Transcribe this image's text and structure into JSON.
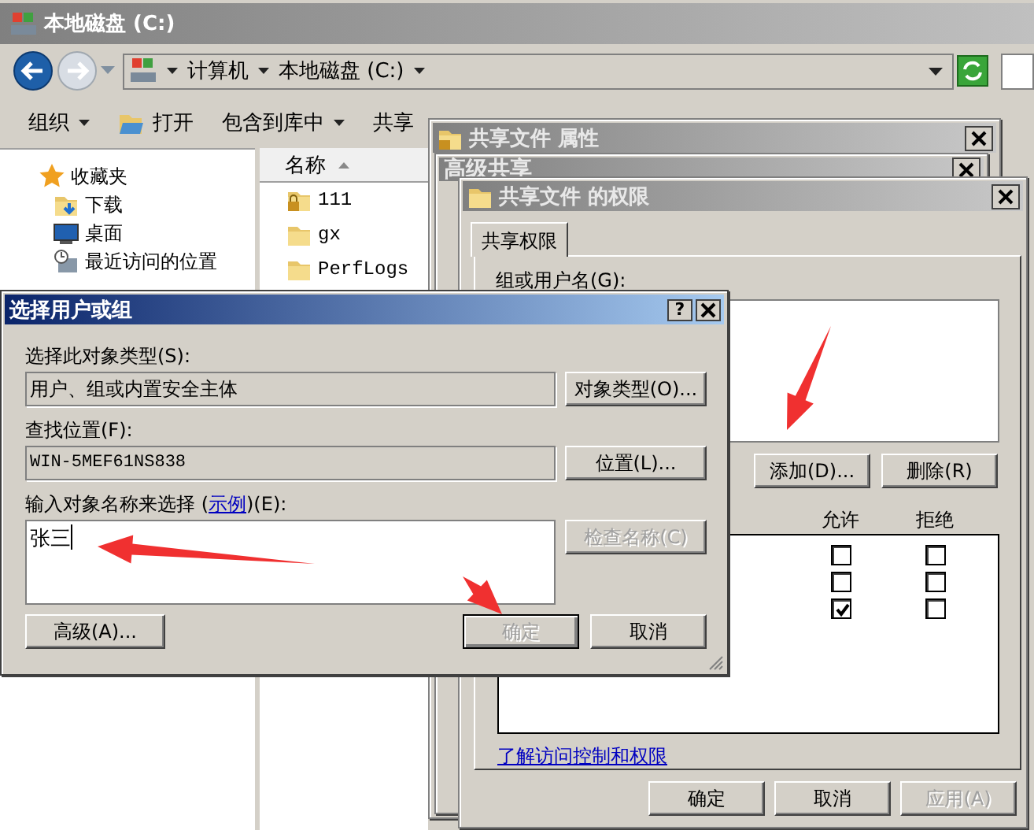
{
  "explorer": {
    "title": "本地磁盘 (C:)",
    "breadcrumb": [
      "计算机",
      "本地磁盘 (C:)"
    ],
    "toolbar": [
      {
        "label": "组织",
        "kind": "menu"
      },
      {
        "label": "打开",
        "kind": "open"
      },
      {
        "label": "包含到库中",
        "kind": "menu"
      },
      {
        "label": "共享",
        "kind": "plain"
      }
    ],
    "nav": [
      {
        "label": "收藏夹",
        "kind": "favorites",
        "children": [
          {
            "label": "下载",
            "kind": "downloads"
          },
          {
            "label": "桌面",
            "kind": "desktop"
          },
          {
            "label": "最近访问的位置",
            "kind": "recent"
          }
        ]
      }
    ],
    "columns": [
      {
        "label": "名称",
        "sorted": true
      }
    ],
    "files": [
      {
        "name": "111",
        "shared": true
      },
      {
        "name": "gx",
        "shared": false
      },
      {
        "name": "PerfLogs",
        "shared": false
      }
    ]
  },
  "properties_window": {
    "title": "共享文件  属性"
  },
  "advanced_sharing": {
    "title": "高级共享"
  },
  "permissions_dialog": {
    "title": "共享文件 的权限",
    "tabs": [
      {
        "label": "共享权限",
        "selected": true
      }
    ],
    "group_label": "组或用户名(G):",
    "group_buttons": [
      {
        "label": "添加(D)...",
        "disabled": false
      },
      {
        "label": "删除(R)",
        "disabled": false
      }
    ],
    "permission_columns": [
      "允许",
      "拒绝"
    ],
    "permissions": [
      {
        "allow": false,
        "deny": false
      },
      {
        "allow": false,
        "deny": false
      },
      {
        "allow": true,
        "deny": false
      }
    ],
    "link": "了解访问控制和权限",
    "buttons": [
      {
        "label": "确定",
        "disabled": false
      },
      {
        "label": "取消",
        "disabled": false
      },
      {
        "label": "应用(A)",
        "disabled": true
      }
    ]
  },
  "select_dialog": {
    "title": "选择用户或组",
    "help_button": "?",
    "object_type_label": "选择此对象类型(S):",
    "object_type": "用户、组或内置安全主体",
    "object_type_button": {
      "label": "对象类型(O)...",
      "disabled": false
    },
    "location_label": "查找位置(F):",
    "location": "WIN-5MEF61NS838",
    "location_button": {
      "label": "位置(L)...",
      "disabled": false
    },
    "name_label": {
      "before": "输入对象名称来选择 (",
      "link": "示例",
      "after": ")(E):"
    },
    "names_value": "张三",
    "check_button": {
      "label": "检查名称(C)",
      "disabled": true
    },
    "buttons": [
      {
        "label": "高级(A)...",
        "disabled": false,
        "default": false
      },
      {
        "label": "确定",
        "disabled": true,
        "default": true
      },
      {
        "label": "取消",
        "disabled": false,
        "default": false
      }
    ]
  }
}
